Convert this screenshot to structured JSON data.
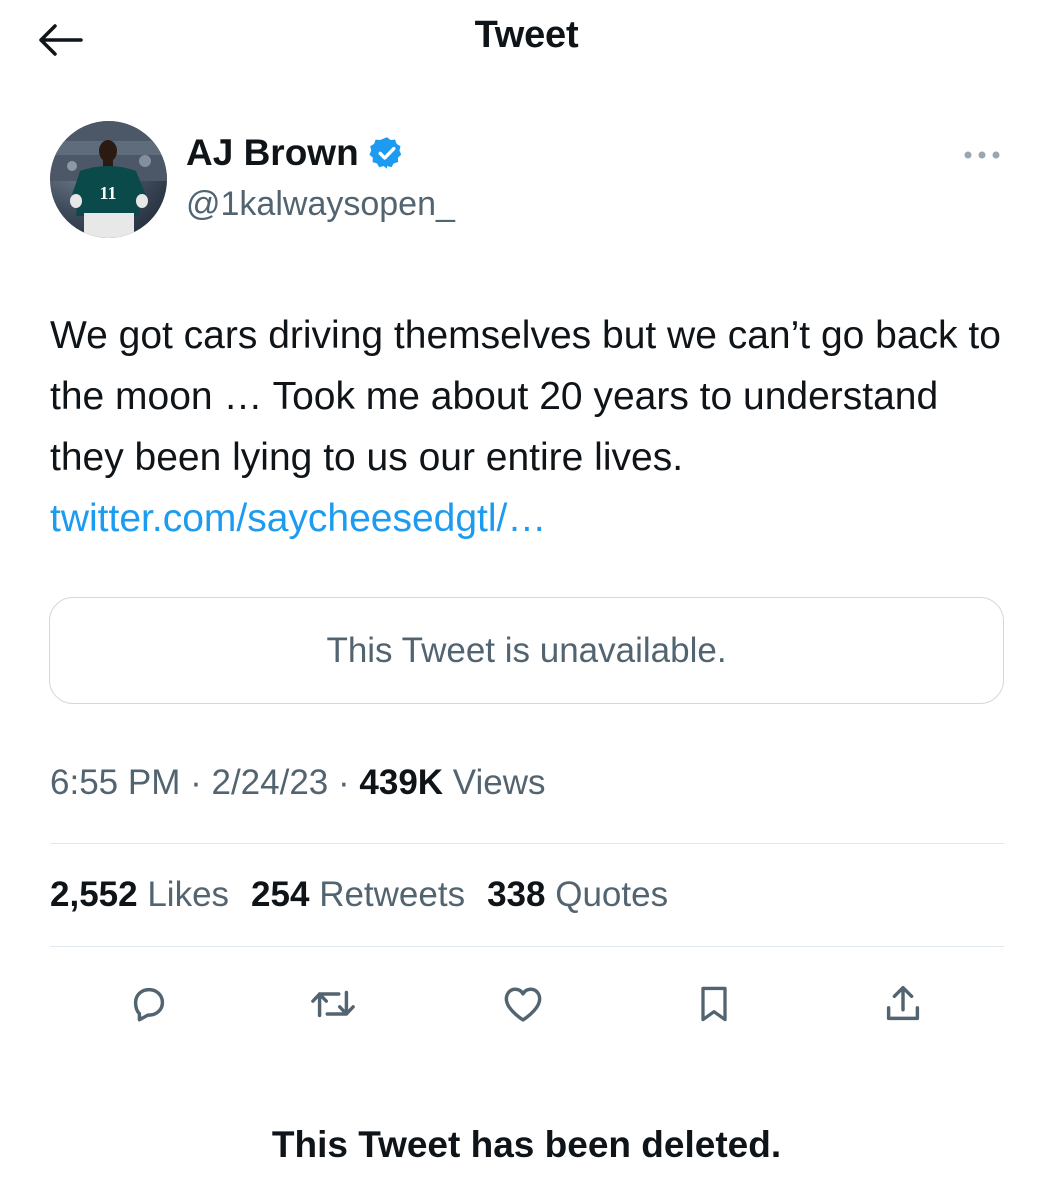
{
  "header": {
    "title": "Tweet",
    "back_icon": "arrow-left-icon"
  },
  "author": {
    "name": "AJ Brown",
    "handle": "@1kalwaysopen_",
    "verified": true,
    "verified_color": "#1d9bf0",
    "avatar_jersey_number": "11",
    "avatar_icon": "profile-photo-football-player"
  },
  "more_icon": "more-horizontal-icon",
  "tweet": {
    "text": "We got cars driving themselves but we can’t go back to the moon … Took me about 20 years to understand they been lying to us our entire lives.",
    "link": "twitter.com/saycheesedgtl/…",
    "link_color": "#1d9bf0"
  },
  "quoted_tweet": {
    "text": "This Tweet is unavailable."
  },
  "meta": {
    "time": "6:55 PM",
    "separator": "·",
    "date": "2/24/23",
    "views_count": "439K",
    "views_label": "Views"
  },
  "stats": {
    "likes_count": "2,552",
    "likes_label": "Likes",
    "retweets_count": "254",
    "retweets_label": "Retweets",
    "quotes_count": "338",
    "quotes_label": "Quotes"
  },
  "actions": [
    {
      "name": "reply",
      "icon": "reply-icon"
    },
    {
      "name": "retweet",
      "icon": "retweet-icon"
    },
    {
      "name": "like",
      "icon": "heart-icon"
    },
    {
      "name": "bookmark",
      "icon": "bookmark-icon"
    },
    {
      "name": "share",
      "icon": "share-icon"
    }
  ],
  "footer": {
    "notice": "This Tweet has been deleted."
  },
  "colors": {
    "text_primary": "#0f1419",
    "text_secondary": "#536471",
    "border": "#cfd9de"
  }
}
